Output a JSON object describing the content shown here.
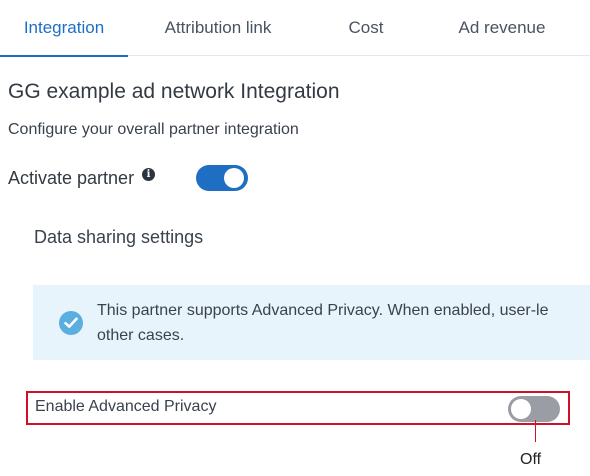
{
  "tabs": [
    {
      "label": "Integration",
      "active": true
    },
    {
      "label": "Attribution link",
      "active": false
    },
    {
      "label": "Cost",
      "active": false
    },
    {
      "label": "Ad revenue",
      "active": false
    }
  ],
  "page": {
    "title": "GG example ad network Integration",
    "subtitle": "Configure your overall partner integration"
  },
  "activate": {
    "label": "Activate partner",
    "info_icon": "info-icon",
    "toggle_state": "on"
  },
  "data_sharing": {
    "title": "Data sharing settings",
    "notice_icon": "check-circle-icon",
    "notice_line1": "This partner supports Advanced Privacy. When enabled, user-le",
    "notice_line2": "other cases."
  },
  "advanced_privacy": {
    "label": "Enable Advanced Privacy",
    "toggle_state": "off"
  },
  "annotation": {
    "callout_text": "Off"
  },
  "colors": {
    "accent": "#1e6fc4",
    "toggle_off": "#9a9ea4",
    "notice_bg": "#e8f4fb",
    "highlight": "#d0102a"
  }
}
